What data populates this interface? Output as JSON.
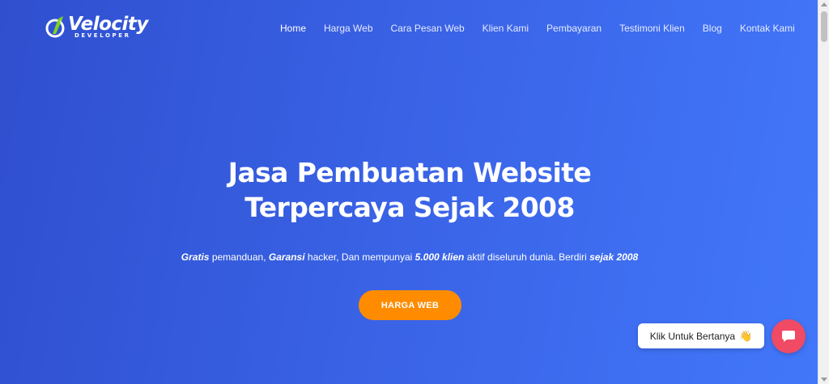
{
  "brand": {
    "name": "Velocity",
    "tagline": "DEVELOPER"
  },
  "nav": {
    "items": [
      {
        "label": "Home",
        "active": true
      },
      {
        "label": "Harga Web",
        "active": false
      },
      {
        "label": "Cara Pesan Web",
        "active": false
      },
      {
        "label": "Klien Kami",
        "active": false
      },
      {
        "label": "Pembayaran",
        "active": false
      },
      {
        "label": "Testimoni Klien",
        "active": false
      },
      {
        "label": "Blog",
        "active": false
      },
      {
        "label": "Kontak Kami",
        "active": false
      }
    ]
  },
  "hero": {
    "title_line1": "Jasa Pembuatan Website",
    "title_line2": "Terpercaya Sejak 2008",
    "subtitle": {
      "free": "Gratis",
      "part1": " pemanduan, ",
      "guarantee": "Garansi",
      "part2": " hacker, Dan mempunyai ",
      "clients": "5.000 klien",
      "part3": " aktif diseluruh dunia. Berdiri ",
      "since": "sejak 2008"
    },
    "cta_label": "HARGA WEB"
  },
  "chat": {
    "prompt": "Klik Untuk Bertanya",
    "prompt_icon": "waving-hand-icon",
    "button_icon": "chat-icon"
  },
  "colors": {
    "hero_gradient_start": "#2f4fcf",
    "hero_gradient_end": "#4277fa",
    "cta": "#ff8c00",
    "chat_button": "#f04a64",
    "logo_accent": "#7ed321"
  }
}
